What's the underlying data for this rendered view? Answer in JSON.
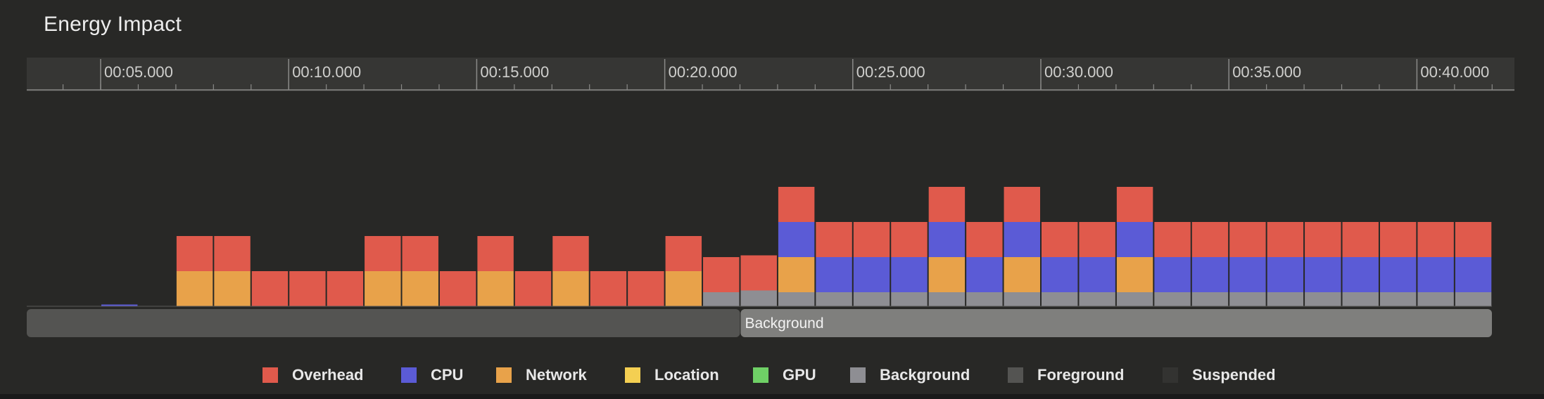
{
  "title": "Energy Impact",
  "chart_data": {
    "type": "bar",
    "stacked": true,
    "title": "Energy Impact",
    "x_unit": "seconds",
    "tick_labels": [
      "00:05.000",
      "00:10.000",
      "00:15.000",
      "00:20.000",
      "00:25.000",
      "00:30.000",
      "00:35.000",
      "00:40.000"
    ],
    "tick_values": [
      5,
      10,
      15,
      20,
      25,
      30,
      35,
      40
    ],
    "xlim": [
      3,
      42.6
    ],
    "bar_width": 1.0,
    "bar_starts": [
      3,
      4,
      5,
      6,
      7,
      8,
      9,
      10,
      11,
      12,
      13,
      14,
      15,
      16,
      17,
      18,
      19,
      20,
      21,
      22,
      23,
      24,
      25,
      26,
      27,
      28,
      29,
      30,
      31,
      32,
      33,
      34,
      35,
      36,
      37,
      38,
      39,
      40,
      41
    ],
    "ylim": [
      0,
      6
    ],
    "series": [
      {
        "name": "Background",
        "color": "#8e8e93",
        "values": [
          0,
          0,
          0,
          0,
          0,
          0,
          0,
          0,
          0,
          0,
          0,
          0,
          0,
          0,
          0,
          0,
          0,
          0,
          0.4,
          0.45,
          0.4,
          0.4,
          0.4,
          0.4,
          0.4,
          0.4,
          0.4,
          0.4,
          0.4,
          0.4,
          0.4,
          0.4,
          0.4,
          0.4,
          0.4,
          0.4,
          0.4,
          0.4,
          0.4
        ]
      },
      {
        "name": "Network",
        "color": "#e8a24a",
        "values": [
          0,
          0,
          0,
          0,
          1,
          1,
          0,
          0,
          0,
          1,
          1,
          0,
          1,
          0,
          1,
          0,
          0,
          1,
          0,
          0,
          1,
          0,
          0,
          0,
          1,
          0,
          1,
          0,
          0,
          1,
          0,
          0,
          0,
          0,
          0,
          0,
          0,
          0,
          0
        ]
      },
      {
        "name": "CPU",
        "color": "#5b5bd6",
        "values": [
          0,
          0,
          0.05,
          0,
          0,
          0,
          0,
          0,
          0,
          0,
          0,
          0,
          0,
          0,
          0,
          0,
          0,
          0,
          0,
          0,
          1,
          1,
          1,
          1,
          1,
          1,
          1,
          1,
          1,
          1,
          1,
          1,
          1,
          1,
          1,
          1,
          1,
          1,
          1
        ]
      },
      {
        "name": "Overhead",
        "color": "#e05a4c",
        "values": [
          0,
          0,
          0,
          0,
          1,
          1,
          1,
          1,
          1,
          1,
          1,
          1,
          1,
          1,
          1,
          1,
          1,
          1,
          1,
          1,
          1,
          1,
          1,
          1,
          1,
          1,
          1,
          1,
          1,
          1,
          1,
          1,
          1,
          1,
          1,
          1,
          1,
          1,
          1
        ]
      }
    ],
    "state_bands": [
      {
        "name": "Foreground",
        "color": "#545452",
        "start": 3,
        "end": 22,
        "label": ""
      },
      {
        "name": "Background",
        "color": "#7f7f7d",
        "start": 22,
        "end": 42,
        "label": "Background"
      }
    ],
    "legend_position": "bottom",
    "grid": false
  },
  "legend": [
    {
      "label": "Overhead",
      "color": "#e05a4c"
    },
    {
      "label": "CPU",
      "color": "#5b5bd6"
    },
    {
      "label": "Network",
      "color": "#e8a24a"
    },
    {
      "label": "Location",
      "color": "#f4cf52"
    },
    {
      "label": "GPU",
      "color": "#6fd066"
    },
    {
      "label": "Background",
      "color": "#8e8e93"
    },
    {
      "label": "Foreground",
      "color": "#545452"
    },
    {
      "label": "Suspended",
      "color": "#333331"
    }
  ]
}
